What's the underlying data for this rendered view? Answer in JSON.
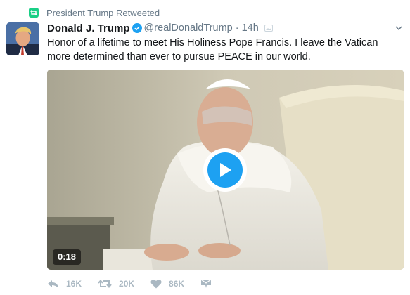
{
  "context": {
    "label": "President Trump Retweeted",
    "icon": "retweet-icon",
    "accent": "#19cf86"
  },
  "author": {
    "name": "Donald J. Trump",
    "handle": "@realDonaldTrump",
    "verified": true
  },
  "meta": {
    "separator": "·",
    "time": "14h"
  },
  "tweet": {
    "text": "Honor of a lifetime to meet His Holiness Pope Francis. I leave the Vatican more determined than ever to pursue PEACE in our world."
  },
  "media": {
    "type": "video",
    "duration": "0:18",
    "play_icon": "play-icon"
  },
  "actions": {
    "reply": {
      "icon": "reply-icon",
      "count": "16K"
    },
    "retweet": {
      "icon": "retweet-icon",
      "count": "20K"
    },
    "like": {
      "icon": "heart-icon",
      "count": "86K"
    },
    "message": {
      "icon": "envelope-icon"
    }
  },
  "colors": {
    "accent": "#1da1f2",
    "muted": "#657786",
    "action_gray": "#aab8c2"
  }
}
